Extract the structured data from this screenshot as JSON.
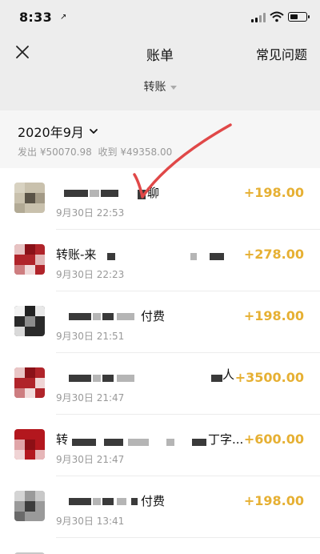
{
  "status_bar": {
    "time": "8:33",
    "location_arrow": "↗"
  },
  "nav": {
    "title": "账单",
    "faq": "常见问题",
    "close_icon": "close-icon"
  },
  "filter": {
    "label": "转账"
  },
  "month": {
    "label": "2020年9月",
    "outgoing": "发出 ¥50070.98",
    "incoming": "收到 ¥49358.00"
  },
  "transactions": [
    {
      "title": "聊",
      "time": "9月30日 22:53",
      "amount": "+198.00"
    },
    {
      "title": "转账-来",
      "time": "9月30日 22:23",
      "amount": "+278.00"
    },
    {
      "title": "付费",
      "time": "9月30日 21:51",
      "amount": "+198.00"
    },
    {
      "title": "人",
      "time": "9月30日 21:47",
      "amount": "+3500.00"
    },
    {
      "title": "转",
      "title_suffix": "丁字...",
      "time": "9月30日 21:47",
      "amount": "+600.00"
    },
    {
      "title": "付费",
      "time": "9月30日 13:41",
      "amount": "+198.00"
    }
  ],
  "colors": {
    "amount": "#e6b033",
    "annotation": "#e04848",
    "background": "#ededed"
  }
}
